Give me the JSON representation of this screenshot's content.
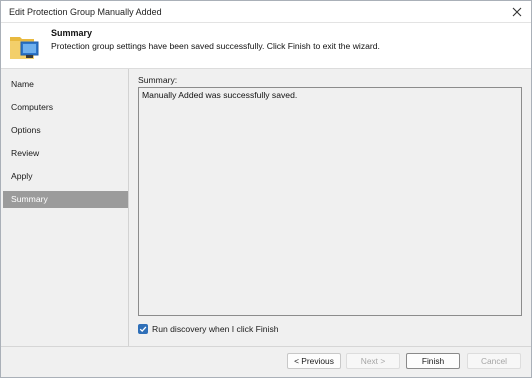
{
  "window": {
    "title": "Edit Protection Group Manually Added"
  },
  "header": {
    "title": "Summary",
    "description": "Protection group settings have been saved successfully. Click Finish to exit the wizard."
  },
  "nav": {
    "items": [
      {
        "label": "Name"
      },
      {
        "label": "Computers"
      },
      {
        "label": "Options"
      },
      {
        "label": "Review"
      },
      {
        "label": "Apply"
      },
      {
        "label": "Summary",
        "active": true
      }
    ]
  },
  "summary": {
    "label": "Summary:",
    "text": "Manually Added was successfully saved."
  },
  "discovery": {
    "label": "Run discovery when I click Finish",
    "checked": true
  },
  "buttons": {
    "previous": "< Previous",
    "next": "Next >",
    "finish": "Finish",
    "cancel": "Cancel"
  },
  "colors": {
    "accent": "#2f6fb8",
    "nav_active": "#9b9b9b"
  },
  "icons": {
    "close": "close-icon",
    "wizard": "folder-computer-icon",
    "check": "checkmark-icon"
  }
}
